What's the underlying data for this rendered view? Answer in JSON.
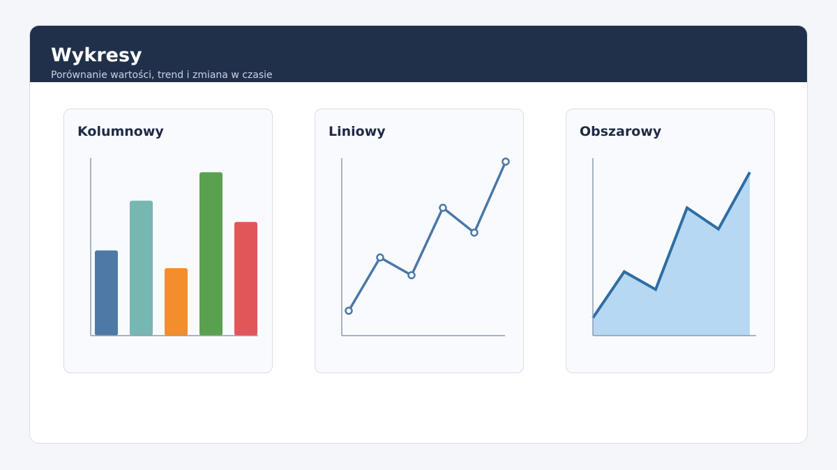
{
  "header": {
    "title": "Wykresy",
    "subtitle": "Porównanie wartości, trend i zmiana w czasie"
  },
  "colors": {
    "header_bg": "#21304a",
    "axis": "#8a9bb5",
    "line": "#4a77a8",
    "area_fill": "#b7d8f2",
    "area_line": "#2f6da3"
  },
  "chart_data": [
    {
      "type": "bar",
      "title": "Kolumnowy",
      "categories": [
        "",
        "",
        "",
        "",
        ""
      ],
      "values": [
        4.8,
        7.6,
        3.8,
        9.2,
        6.4
      ],
      "colors": [
        "#4e79a7",
        "#76b7b2",
        "#f28e2b",
        "#59a14f",
        "#e15759"
      ],
      "ylim": [
        0,
        10
      ],
      "grid": false
    },
    {
      "type": "line",
      "title": "Liniowy",
      "x": [
        1,
        2,
        3,
        4,
        5,
        6
      ],
      "values": [
        1.4,
        4.4,
        3.4,
        7.2,
        5.8,
        9.8
      ],
      "ylim": [
        0,
        10
      ],
      "markers": true,
      "grid": false
    },
    {
      "type": "area",
      "title": "Obszarowy",
      "x": [
        1,
        2,
        3,
        4,
        5,
        6
      ],
      "values": [
        1.0,
        3.6,
        2.6,
        7.2,
        6.0,
        9.2
      ],
      "ylim": [
        0,
        10
      ],
      "grid": false
    }
  ]
}
